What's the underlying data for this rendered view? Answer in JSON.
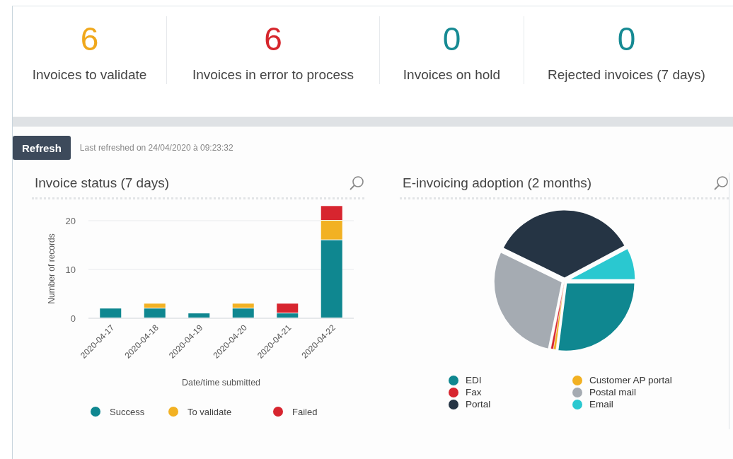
{
  "stats": [
    {
      "value": "6",
      "label": "Invoices to validate",
      "color": "#f0a81c"
    },
    {
      "value": "6",
      "label": "Invoices in error to process",
      "color": "#d6262c"
    },
    {
      "value": "0",
      "label": "Invoices on hold",
      "color": "#168a93"
    },
    {
      "value": "0",
      "label": "Rejected invoices (7 days)",
      "color": "#168a93"
    }
  ],
  "refresh": {
    "button": "Refresh",
    "last_refreshed": "Last refreshed on 24/04/2020 à 09:23:32"
  },
  "invoice_status": {
    "title": "Invoice status (7 days)",
    "chart_data": {
      "type": "bar",
      "stacked": true,
      "xlabel": "Date/time submitted",
      "ylabel": "Number of records",
      "categories": [
        "2020-04-17",
        "2020-04-18",
        "2020-04-19",
        "2020-04-20",
        "2020-04-21",
        "2020-04-22"
      ],
      "legend": "bottom",
      "ylim": [
        0,
        23
      ],
      "yticks": [
        0,
        10,
        20
      ],
      "series": [
        {
          "name": "Success",
          "color": "#0f8790",
          "values": [
            2,
            2,
            1,
            2,
            1,
            16
          ]
        },
        {
          "name": "To validate",
          "color": "#f2b123",
          "values": [
            0,
            1,
            0,
            1,
            0,
            4
          ]
        },
        {
          "name": "Failed",
          "color": "#d7252f",
          "values": [
            0,
            0,
            0,
            0,
            2,
            3
          ]
        }
      ]
    }
  },
  "adoption": {
    "title": "E-invoicing adoption (2 months)",
    "legend": [
      {
        "label": "EDI",
        "color": "#0f8790"
      },
      {
        "label": "Customer AP portal",
        "color": "#f2b123"
      },
      {
        "label": "Fax",
        "color": "#d7252f"
      },
      {
        "label": "Postal mail",
        "color": "#a5abb2"
      },
      {
        "label": "Portal",
        "color": "#253444"
      },
      {
        "label": "Email",
        "color": "#2ac8d0"
      }
    ]
  }
}
